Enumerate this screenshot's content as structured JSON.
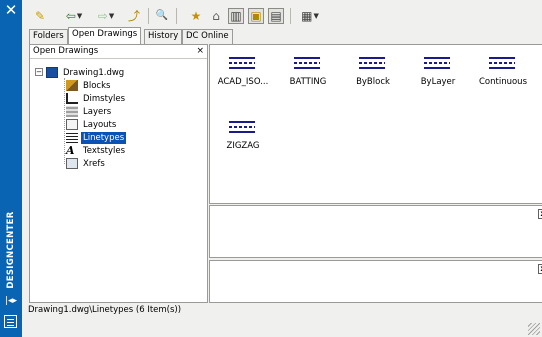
{
  "palette": {
    "title": "DESIGNCENTER",
    "close_glyph": "✕",
    "autohide_glyph": "|◂▸",
    "accent": "#0a64b4"
  },
  "toolbar": {
    "buttons": [
      {
        "icon": "load-icon",
        "glyph": "✎"
      },
      {
        "icon": "back-icon",
        "glyph": "⇦",
        "dropdown": true
      },
      {
        "icon": "forward-icon",
        "glyph": "⇨",
        "dropdown": true
      },
      {
        "icon": "up-icon",
        "glyph": "⤴"
      },
      {
        "icon": "search-icon",
        "glyph": "🔍"
      },
      {
        "icon": "favorites-icon",
        "glyph": "★"
      },
      {
        "icon": "home-icon",
        "glyph": "⌂"
      },
      {
        "icon": "tree-view-toggle-icon",
        "glyph": "▥"
      },
      {
        "icon": "preview-toggle-icon",
        "glyph": "▣"
      },
      {
        "icon": "description-toggle-icon",
        "glyph": "▤"
      },
      {
        "icon": "views-icon",
        "glyph": "▦",
        "dropdown": true
      }
    ]
  },
  "tabs": [
    "Folders",
    "Open Drawings",
    "History",
    "DC Online"
  ],
  "active_tab": "Open Drawings",
  "tree": {
    "header": "Open Drawings",
    "close_glyph": "×",
    "root": "Drawing1.dwg",
    "items": [
      "Blocks",
      "Dimstyles",
      "Layers",
      "Layouts",
      "Linetypes",
      "Textstyles",
      "Xrefs"
    ],
    "selected": "Linetypes"
  },
  "linetypes": [
    "ACAD_ISO...",
    "BATTING",
    "ByBlock",
    "ByLayer",
    "Continuous",
    "ZIGZAG"
  ],
  "panes": {
    "close_glyph": "x",
    "scroll_up": "⌃",
    "scroll_down": "⌄"
  },
  "status": "Drawing1.dwg\\Linetypes (6 Item(s))"
}
